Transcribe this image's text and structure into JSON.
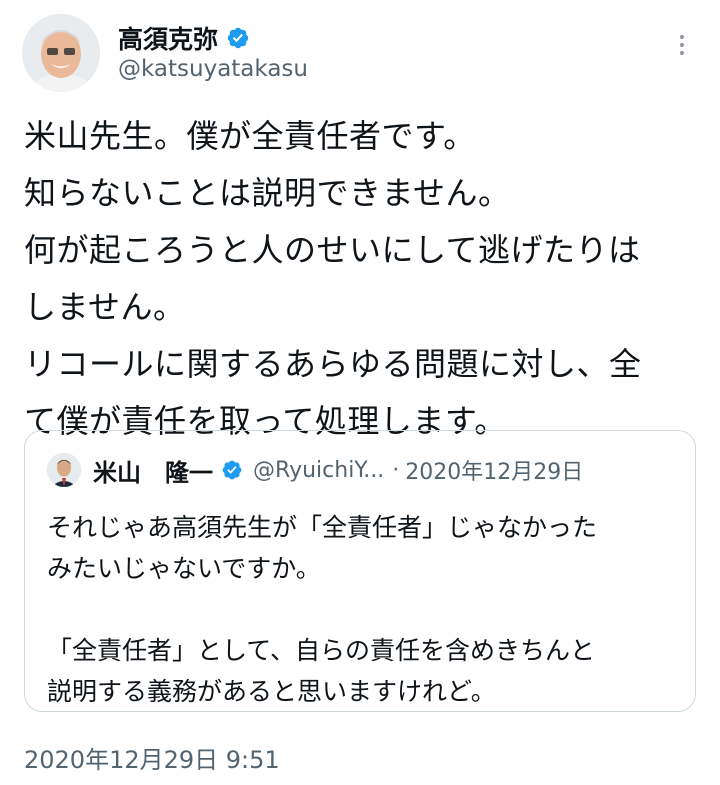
{
  "author": {
    "display_name": "高須克弥",
    "handle": "@katsuyatakasu",
    "verified": true,
    "avatar_icon": "avatar-photo"
  },
  "tweet": {
    "lines": [
      "米山先生。僕が全責任者です。",
      "知らないことは説明できません。",
      "何が起ころうと人のせいにして逃げたりは",
      "しません。",
      "リコールに関するあらゆる問題に対し、全",
      "て僕が責任を取って処理します。"
    ],
    "timestamp": "2020年12月29日 9:51"
  },
  "quoted_tweet": {
    "display_name": "米山　隆一",
    "handle": "@RyuichiY...",
    "separator": "·",
    "date": "2020年12月29日",
    "lines": [
      "それじゃあ高須先生が「全責任者」じゃなかった",
      "みたいじゃないですか。",
      "",
      "「全責任者」として、自らの責任を含めきちんと",
      "説明する義務があると思いますけれど。"
    ]
  },
  "colors": {
    "verified_badge": "#1d9bf0",
    "text_primary": "#0f1419",
    "text_secondary": "#536471",
    "border": "#cfd9de"
  },
  "icons": {
    "more": "more-options-icon",
    "verified": "verified-badge-icon"
  }
}
